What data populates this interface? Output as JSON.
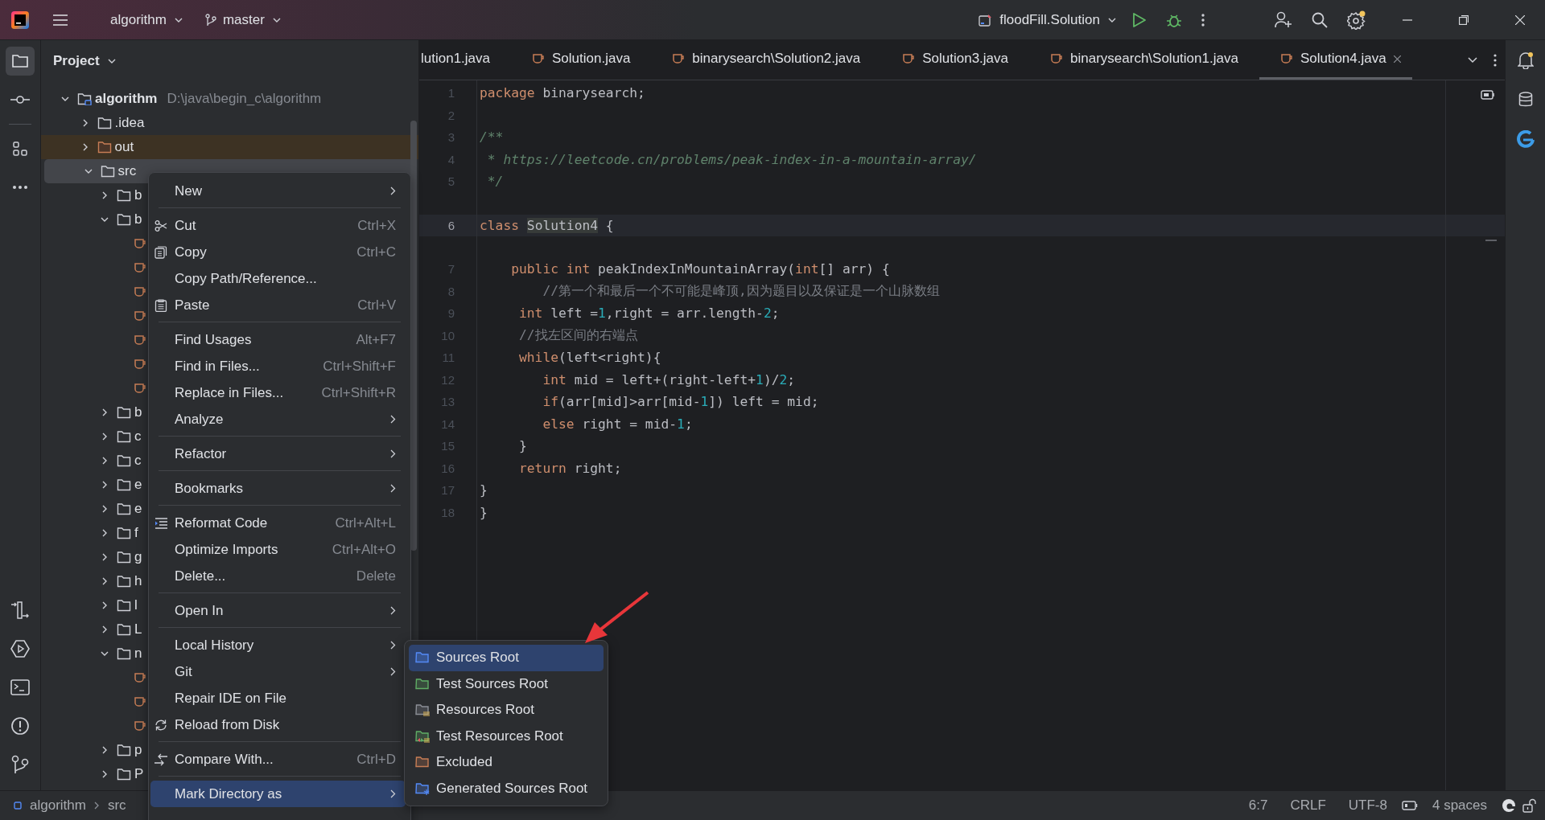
{
  "title_bar": {
    "project": "algorithm",
    "branch": "master",
    "run_configuration": "floodFill.Solution"
  },
  "tool_strip": [
    {
      "kind": "project",
      "selected": true
    },
    {
      "kind": "commit",
      "selected": false
    },
    {
      "kind": "structure",
      "selected": false
    },
    {
      "kind": "more",
      "selected": false
    },
    {
      "kind": "pull",
      "selected": false
    },
    {
      "kind": "services",
      "selected": false
    },
    {
      "kind": "terminal",
      "selected": false
    },
    {
      "kind": "problems",
      "selected": false
    },
    {
      "kind": "git",
      "selected": false
    }
  ],
  "project_panel": {
    "title": "Project",
    "tree": [
      {
        "label": "algorithm",
        "path": "D:\\java\\begin_c\\algorithm",
        "kind": "module",
        "expanded": true,
        "selected": false,
        "children": [
          {
            "label": ".idea",
            "kind": "folder",
            "expanded": false,
            "selected": false
          },
          {
            "label": "out",
            "kind": "excluded",
            "expanded": false,
            "selected": false
          },
          {
            "label": "src",
            "kind": "folder",
            "expanded": true,
            "selected": true,
            "children": [
              {
                "label": "b",
                "kind": "folder",
                "expanded": false,
                "selected": false
              },
              {
                "label": "b",
                "kind": "folder",
                "expanded": true,
                "selected": false,
                "children": [
                  {
                    "kind": "java",
                    "selected": false
                  },
                  {
                    "kind": "java",
                    "selected": false
                  },
                  {
                    "kind": "java",
                    "selected": false
                  },
                  {
                    "kind": "java",
                    "selected": false
                  },
                  {
                    "kind": "java",
                    "selected": false
                  },
                  {
                    "kind": "java",
                    "selected": false
                  },
                  {
                    "kind": "java",
                    "selected": false
                  }
                ]
              },
              {
                "label": "b",
                "kind": "folder",
                "expanded": false,
                "selected": false
              },
              {
                "label": "c",
                "kind": "folder",
                "expanded": false,
                "selected": false
              },
              {
                "label": "c",
                "kind": "folder",
                "expanded": false,
                "selected": false
              },
              {
                "label": "e",
                "kind": "folder",
                "expanded": false,
                "selected": false
              },
              {
                "label": "e",
                "kind": "folder",
                "expanded": false,
                "selected": false
              },
              {
                "label": "f",
                "kind": "folder",
                "expanded": false,
                "selected": false
              },
              {
                "label": "g",
                "kind": "folder",
                "expanded": false,
                "selected": false
              },
              {
                "label": "h",
                "kind": "folder",
                "expanded": false,
                "selected": false
              },
              {
                "label": "l",
                "kind": "folder",
                "expanded": false,
                "selected": false
              },
              {
                "label": "L",
                "kind": "folder",
                "expanded": false,
                "selected": false
              },
              {
                "label": "n",
                "kind": "folder",
                "expanded": true,
                "selected": false,
                "children": [
                  {
                    "kind": "java",
                    "selected": false
                  },
                  {
                    "kind": "java",
                    "selected": false
                  },
                  {
                    "kind": "java",
                    "selected": false
                  }
                ]
              },
              {
                "label": "p",
                "kind": "folder",
                "expanded": false,
                "selected": false
              },
              {
                "label": "P",
                "kind": "folder",
                "expanded": false,
                "selected": false
              }
            ]
          }
        ]
      }
    ]
  },
  "tabs": [
    {
      "label": "lution1.java",
      "icon_visible": false,
      "selected": false
    },
    {
      "label": "Solution.java",
      "icon_visible": true,
      "selected": false
    },
    {
      "label": "binarysearch\\Solution2.java",
      "icon_visible": true,
      "selected": false
    },
    {
      "label": "Solution3.java",
      "icon_visible": true,
      "selected": false
    },
    {
      "label": "binarysearch\\Solution1.java",
      "icon_visible": true,
      "selected": false
    },
    {
      "label": "Solution4.java",
      "icon_visible": true,
      "selected": true
    }
  ],
  "editor": {
    "lines": [
      {
        "number": "1",
        "current": false,
        "tokens": [
          {
            "kind": "keyword",
            "text": "package"
          },
          {
            "kind": "plain",
            "text": " binarysearch;"
          }
        ]
      },
      {
        "number": "2",
        "current": false
      },
      {
        "number": "3",
        "current": false,
        "tokens": [
          {
            "kind": "doc",
            "text": "/**"
          }
        ]
      },
      {
        "number": "4",
        "current": false,
        "tokens": [
          {
            "kind": "doc",
            "text": " * https://leetcode.cn/problems/peak-index-in-a-mountain-array/"
          }
        ]
      },
      {
        "number": "5",
        "current": false,
        "tokens": [
          {
            "kind": "doc",
            "text": " */"
          }
        ]
      },
      {
        "number": "6",
        "current": true,
        "tokens": [
          {
            "kind": "keyword",
            "text": "class "
          },
          {
            "kind": "declaration",
            "text": "Solution4"
          },
          {
            "kind": "plain",
            "text": " {"
          }
        ]
      },
      {
        "number": "7",
        "current": false,
        "tokens": [
          {
            "kind": "keyword",
            "text": "    public int"
          },
          {
            "kind": "plain",
            "text": " peakIndexInMountainArray("
          },
          {
            "kind": "keyword",
            "text": "int"
          },
          {
            "kind": "plain",
            "text": "[] arr) {"
          }
        ]
      },
      {
        "number": "8",
        "current": false,
        "tokens": [
          {
            "kind": "comment",
            "text": "        //第一个和最后一个不可能是峰顶,因为题目以及保证是一个山脉数组"
          }
        ]
      },
      {
        "number": "9",
        "current": false,
        "tokens": [
          {
            "kind": "keyword",
            "text": "     int"
          },
          {
            "kind": "plain",
            "text": " left ="
          },
          {
            "kind": "number",
            "text": "1"
          },
          {
            "kind": "plain",
            "text": ",right = arr.length-"
          },
          {
            "kind": "number",
            "text": "2"
          },
          {
            "kind": "plain",
            "text": ";"
          }
        ]
      },
      {
        "number": "10",
        "current": false,
        "tokens": [
          {
            "kind": "comment",
            "text": "     //找左区间的右端点"
          }
        ]
      },
      {
        "number": "11",
        "current": false,
        "tokens": [
          {
            "kind": "keyword",
            "text": "     while"
          },
          {
            "kind": "plain",
            "text": "(left<right){"
          }
        ]
      },
      {
        "number": "12",
        "current": false,
        "tokens": [
          {
            "kind": "keyword",
            "text": "        int"
          },
          {
            "kind": "plain",
            "text": " mid = left+(right-left+"
          },
          {
            "kind": "number",
            "text": "1"
          },
          {
            "kind": "plain",
            "text": ")/"
          },
          {
            "kind": "number",
            "text": "2"
          },
          {
            "kind": "plain",
            "text": ";"
          }
        ]
      },
      {
        "number": "13",
        "current": false,
        "tokens": [
          {
            "kind": "keyword",
            "text": "        if"
          },
          {
            "kind": "plain",
            "text": "(arr[mid]>arr[mid-"
          },
          {
            "kind": "number",
            "text": "1"
          },
          {
            "kind": "plain",
            "text": "]) left = mid;"
          }
        ]
      },
      {
        "number": "14",
        "current": false,
        "tokens": [
          {
            "kind": "keyword",
            "text": "        else"
          },
          {
            "kind": "plain",
            "text": " right = mid-"
          },
          {
            "kind": "number",
            "text": "1"
          },
          {
            "kind": "plain",
            "text": ";"
          }
        ]
      },
      {
        "number": "15",
        "current": false,
        "tokens": [
          {
            "kind": "plain",
            "text": "     }"
          }
        ]
      },
      {
        "number": "16",
        "current": false,
        "tokens": [
          {
            "kind": "keyword",
            "text": "     return"
          },
          {
            "kind": "plain",
            "text": " right;"
          }
        ]
      },
      {
        "number": "17",
        "current": false,
        "tokens": [
          {
            "kind": "plain",
            "text": "}"
          }
        ]
      },
      {
        "number": "18",
        "current": false,
        "tokens": [
          {
            "kind": "plain",
            "text": "}"
          }
        ]
      }
    ]
  },
  "context_menu": {
    "items": [
      {
        "kind": "item",
        "label": "New",
        "submenu": true,
        "selected": false
      },
      {
        "kind": "separator"
      },
      {
        "kind": "item",
        "label": "Cut",
        "shortcut": "Ctrl+X",
        "submenu": false,
        "selected": false
      },
      {
        "kind": "item",
        "label": "Copy",
        "shortcut": "Ctrl+C",
        "submenu": false,
        "selected": false
      },
      {
        "kind": "item",
        "label": "Copy Path/Reference...",
        "submenu": false,
        "selected": false
      },
      {
        "kind": "item",
        "label": "Paste",
        "shortcut": "Ctrl+V",
        "submenu": false,
        "selected": false
      },
      {
        "kind": "separator"
      },
      {
        "kind": "item",
        "label": "Find Usages",
        "shortcut": "Alt+F7",
        "submenu": false,
        "selected": false
      },
      {
        "kind": "item",
        "label": "Find in Files...",
        "shortcut": "Ctrl+Shift+F",
        "submenu": false,
        "selected": false
      },
      {
        "kind": "item",
        "label": "Replace in Files...",
        "shortcut": "Ctrl+Shift+R",
        "submenu": false,
        "selected": false
      },
      {
        "kind": "item",
        "label": "Analyze",
        "submenu": true,
        "selected": false
      },
      {
        "kind": "separator"
      },
      {
        "kind": "item",
        "label": "Refactor",
        "submenu": true,
        "selected": false
      },
      {
        "kind": "separator"
      },
      {
        "kind": "item",
        "label": "Bookmarks",
        "submenu": true,
        "selected": false
      },
      {
        "kind": "separator"
      },
      {
        "kind": "item",
        "label": "Reformat Code",
        "shortcut": "Ctrl+Alt+L",
        "submenu": false,
        "selected": false
      },
      {
        "kind": "item",
        "label": "Optimize Imports",
        "shortcut": "Ctrl+Alt+O",
        "submenu": false,
        "selected": false
      },
      {
        "kind": "item",
        "label": "Delete...",
        "shortcut": "Delete",
        "submenu": false,
        "selected": false
      },
      {
        "kind": "separator"
      },
      {
        "kind": "item",
        "label": "Open In",
        "submenu": true,
        "selected": false
      },
      {
        "kind": "separator"
      },
      {
        "kind": "item",
        "label": "Local History",
        "submenu": true,
        "selected": false
      },
      {
        "kind": "item",
        "label": "Git",
        "submenu": true,
        "selected": false
      },
      {
        "kind": "item",
        "label": "Repair IDE on File",
        "submenu": false,
        "selected": false
      },
      {
        "kind": "item",
        "label": "Reload from Disk",
        "submenu": false,
        "selected": false
      },
      {
        "kind": "separator"
      },
      {
        "kind": "item",
        "label": "Compare With...",
        "shortcut": "Ctrl+D",
        "submenu": false,
        "selected": false
      },
      {
        "kind": "separator"
      },
      {
        "kind": "item",
        "label": "Mark Directory as",
        "submenu": true,
        "selected": true
      }
    ]
  },
  "submenu": {
    "items": [
      {
        "label": "Sources Root",
        "kind": "plain",
        "color": "#548af7",
        "selected": true
      },
      {
        "label": "Test Sources Root",
        "kind": "plain",
        "color": "#5fad65",
        "selected": false
      },
      {
        "label": "Resources Root",
        "kind": "resources",
        "color": "#8c8f96",
        "selected": false
      },
      {
        "label": "Test Resources Root",
        "kind": "test_resources",
        "color": "#5fad65",
        "selected": false
      },
      {
        "label": "Excluded",
        "kind": "plain",
        "color": "#c77d55",
        "selected": false
      },
      {
        "label": "Generated Sources Root",
        "kind": "generated",
        "color": "#548af7",
        "selected": false
      }
    ]
  },
  "status_bar": {
    "breadcrumbs": [
      "algorithm",
      "src"
    ],
    "position": "6:7",
    "line_ending": "CRLF",
    "encoding": "UTF-8",
    "indent": "4 spaces"
  }
}
